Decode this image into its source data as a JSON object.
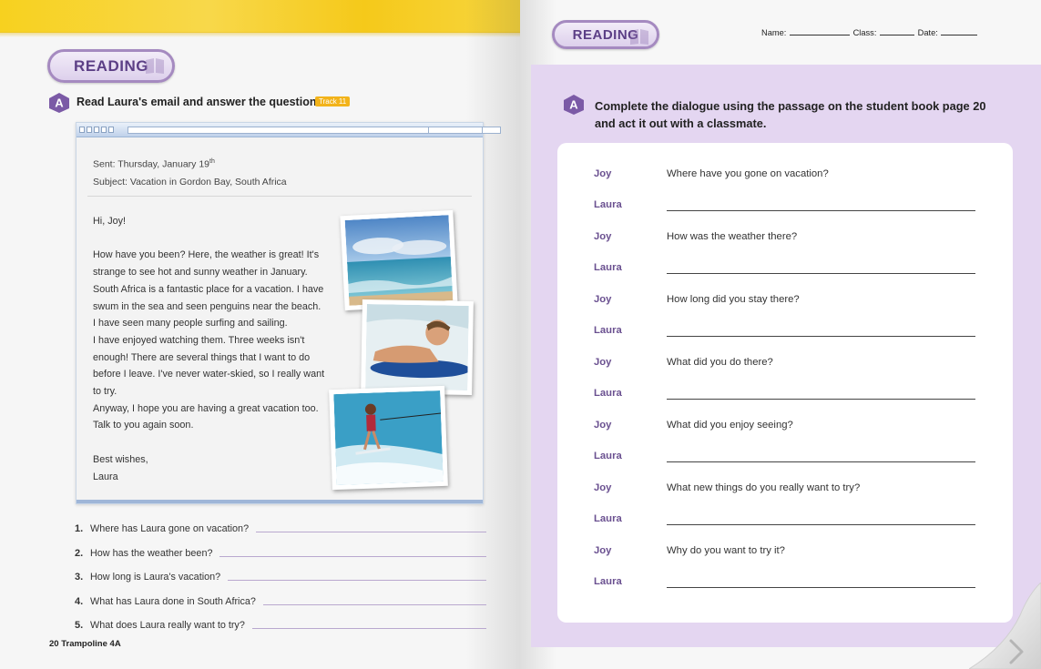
{
  "left": {
    "badge": "READING",
    "instruction": "Read Laura's email and answer the questions.",
    "track": "Track 11",
    "email": {
      "sent_prefix": "Sent: Thursday, January 19",
      "sent_sup": "th",
      "subject": "Subject: Vacation in Gordon Bay, South Africa",
      "greeting": "Hi, Joy!",
      "para1": [
        "How have you been? Here, the weather is great! It's",
        "strange to see hot and sunny weather in January.",
        "South Africa is a fantastic place for a vacation. I have",
        "swum in the sea and seen penguins near the beach.",
        "I have seen many people surfing and sailing.",
        "I have enjoyed watching them. Three weeks isn't",
        "enough! There are several things that I want to do",
        "before I leave. I've never water-skied, so I really want",
        "to try.",
        "Anyway, I hope you are having a great vacation too.",
        "Talk to you again soon."
      ],
      "closing": "Best wishes,",
      "signature": "Laura"
    },
    "questions": [
      {
        "num": "1.",
        "text": "Where has Laura gone on vacation?"
      },
      {
        "num": "2.",
        "text": "How has the weather been?"
      },
      {
        "num": "3.",
        "text": "How long is Laura's vacation?"
      },
      {
        "num": "4.",
        "text": "What has Laura done in South Africa?"
      },
      {
        "num": "5.",
        "text": "What does Laura really want to try?"
      }
    ],
    "footer_page": "20",
    "footer_book": "Trampoline 4A"
  },
  "right": {
    "badge": "READING",
    "name_label": "Name:",
    "class_label": "Class:",
    "date_label": "Date:",
    "instruction": "Complete the dialogue using the passage on the student book page 20 and act it out with a classmate.",
    "dialogue": [
      {
        "speaker": "Joy",
        "text": "Where have you gone on vacation?"
      },
      {
        "speaker": "Laura",
        "text": ""
      },
      {
        "speaker": "Joy",
        "text": "How was the weather there?"
      },
      {
        "speaker": "Laura",
        "text": ""
      },
      {
        "speaker": "Joy",
        "text": "How long did you stay there?"
      },
      {
        "speaker": "Laura",
        "text": ""
      },
      {
        "speaker": "Joy",
        "text": "What did you do there?"
      },
      {
        "speaker": "Laura",
        "text": ""
      },
      {
        "speaker": "Joy",
        "text": "What did you enjoy seeing?"
      },
      {
        "speaker": "Laura",
        "text": ""
      },
      {
        "speaker": "Joy",
        "text": "What new things do you really want to try?"
      },
      {
        "speaker": "Laura",
        "text": ""
      },
      {
        "speaker": "Joy",
        "text": "Why do you want to try it?"
      },
      {
        "speaker": "Laura",
        "text": ""
      }
    ]
  },
  "icons": {
    "section_badge": "a-section-icon",
    "page_turn": "page-curl-arrow-icon"
  },
  "colors": {
    "accent_purple": "#6a5090",
    "panel_purple": "#e4d6f1",
    "top_yellow": "#f7d11f",
    "track_orange": "#f2b31a"
  }
}
